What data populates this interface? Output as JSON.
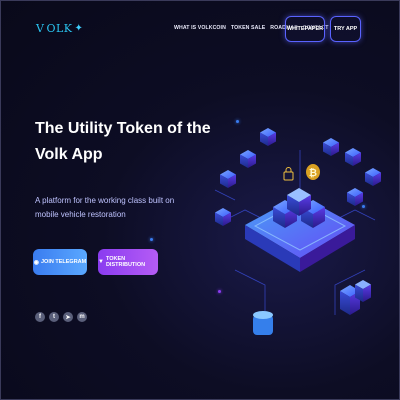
{
  "header": {
    "logo_text": "OLK",
    "nav": [
      "WHAT IS VOLKCOIN",
      "TOKEN SALE",
      "ROADMAP",
      "CONTACT"
    ],
    "whitepaper_label": "WHITEPAPER",
    "tryapp_label": "TRY APP"
  },
  "hero": {
    "title": "The Utility Token of the Volk App",
    "subtitle": "A platform for the working class built on mobile vehicle restoration",
    "telegram_label": "JOIN TELEGRAM",
    "distribution_label": "TOKEN DISTRIBUTION"
  },
  "socials": [
    {
      "icon": "facebook-icon",
      "glyph": "f"
    },
    {
      "icon": "twitter-icon",
      "glyph": "t"
    },
    {
      "icon": "telegram-icon",
      "glyph": "➤"
    },
    {
      "icon": "medium-icon",
      "glyph": "m"
    }
  ],
  "illustration": {
    "coin_symbol": "₿"
  },
  "colors": {
    "accent": "#5a63ff",
    "telegram": "#3a7cf0",
    "distribution": "#9a4cf0",
    "cube": "#4f7dff",
    "coin": "#f0b020"
  }
}
